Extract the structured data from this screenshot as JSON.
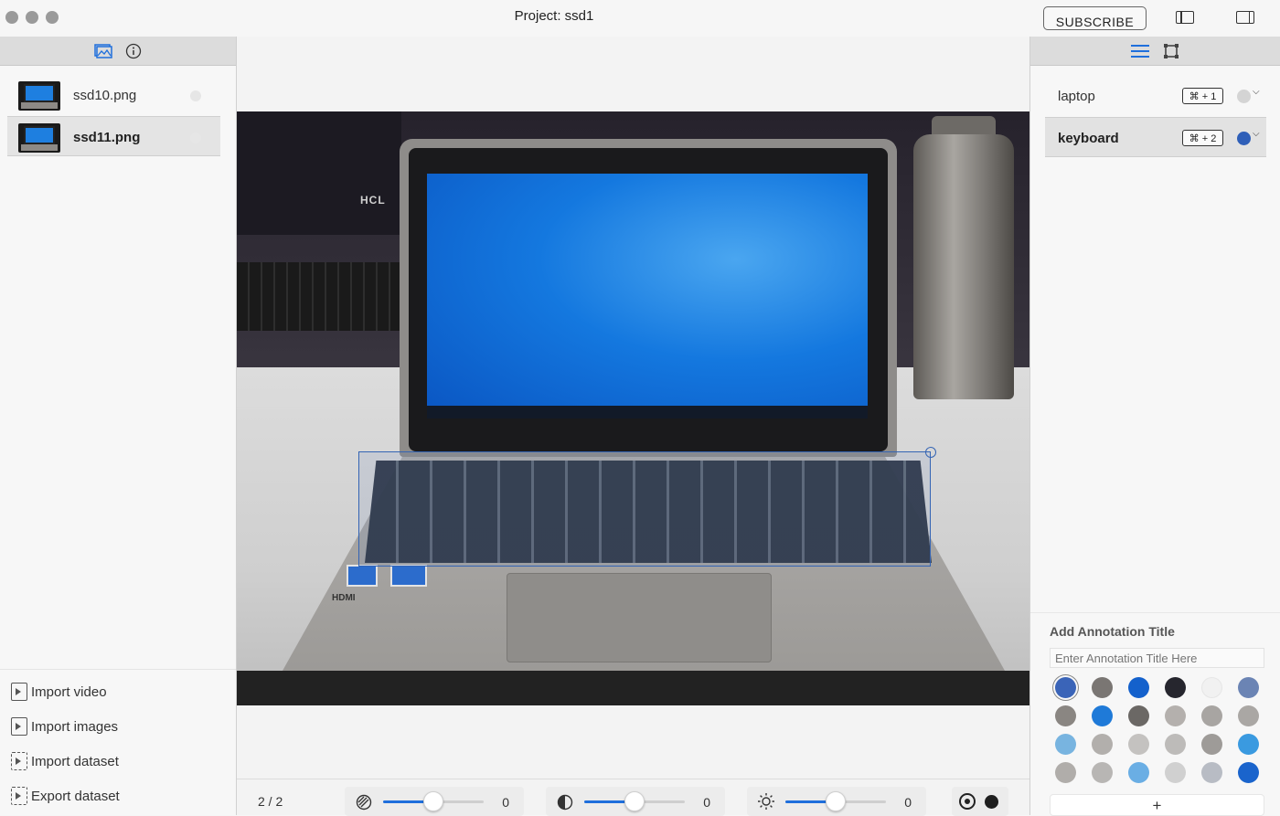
{
  "window": {
    "title": "Project: ssd1",
    "subscribe_label": "SUBSCRIBE"
  },
  "left_sidebar": {
    "files": [
      {
        "name": "ssd10.png",
        "selected": false
      },
      {
        "name": "ssd11.png",
        "selected": true
      }
    ],
    "actions": [
      {
        "label": "Import video",
        "icon": "import-video-icon"
      },
      {
        "label": "Import images",
        "icon": "import-images-icon"
      },
      {
        "label": "Import dataset",
        "icon": "import-dataset-icon"
      },
      {
        "label": "Export dataset",
        "icon": "export-dataset-icon"
      }
    ]
  },
  "canvas": {
    "annotation": {
      "label": "keyboard",
      "color": "#3464b4"
    },
    "photo_text": {
      "monitor": "HCL",
      "port": "HDMI"
    }
  },
  "bottom_toolbar": {
    "page_count": "2 / 2",
    "sliders": [
      {
        "name": "opacity",
        "icon": "hatch-icon",
        "value": "0",
        "level": 0.5
      },
      {
        "name": "contrast",
        "icon": "contrast-icon",
        "value": "0",
        "level": 0.5
      },
      {
        "name": "brightness",
        "icon": "brightness-icon",
        "value": "0",
        "level": 0.5
      }
    ],
    "target_color": "#1f1f1f"
  },
  "right_sidebar": {
    "labels": [
      {
        "name": "laptop",
        "shortcut": "⌘ + 1",
        "color": "#d4d4d4",
        "selected": false
      },
      {
        "name": "keyboard",
        "shortcut": "⌘ + 2",
        "color": "#2f5fb8",
        "selected": true
      }
    ],
    "add_annotation": {
      "title": "Add Annotation Title",
      "placeholder": "Enter Annotation Title Here",
      "add_label": "+",
      "palette": [
        "#3a64b8",
        "#7a7673",
        "#1461cc",
        "#26262e",
        "#f1f1f1",
        "#6b84b4",
        "#8a8682",
        "#1f7ad8",
        "#6b6865",
        "#b4b0ad",
        "#a8a5a2",
        "#aaa7a4",
        "#78b4e0",
        "#b2afac",
        "#c4c2c0",
        "#bdbbb9",
        "#9e9b98",
        "#3a9ae0",
        "#b0adaa",
        "#b8b6b4",
        "#6aaee4",
        "#d0d0d0",
        "#b8bcc4",
        "#1a64cc"
      ]
    }
  }
}
